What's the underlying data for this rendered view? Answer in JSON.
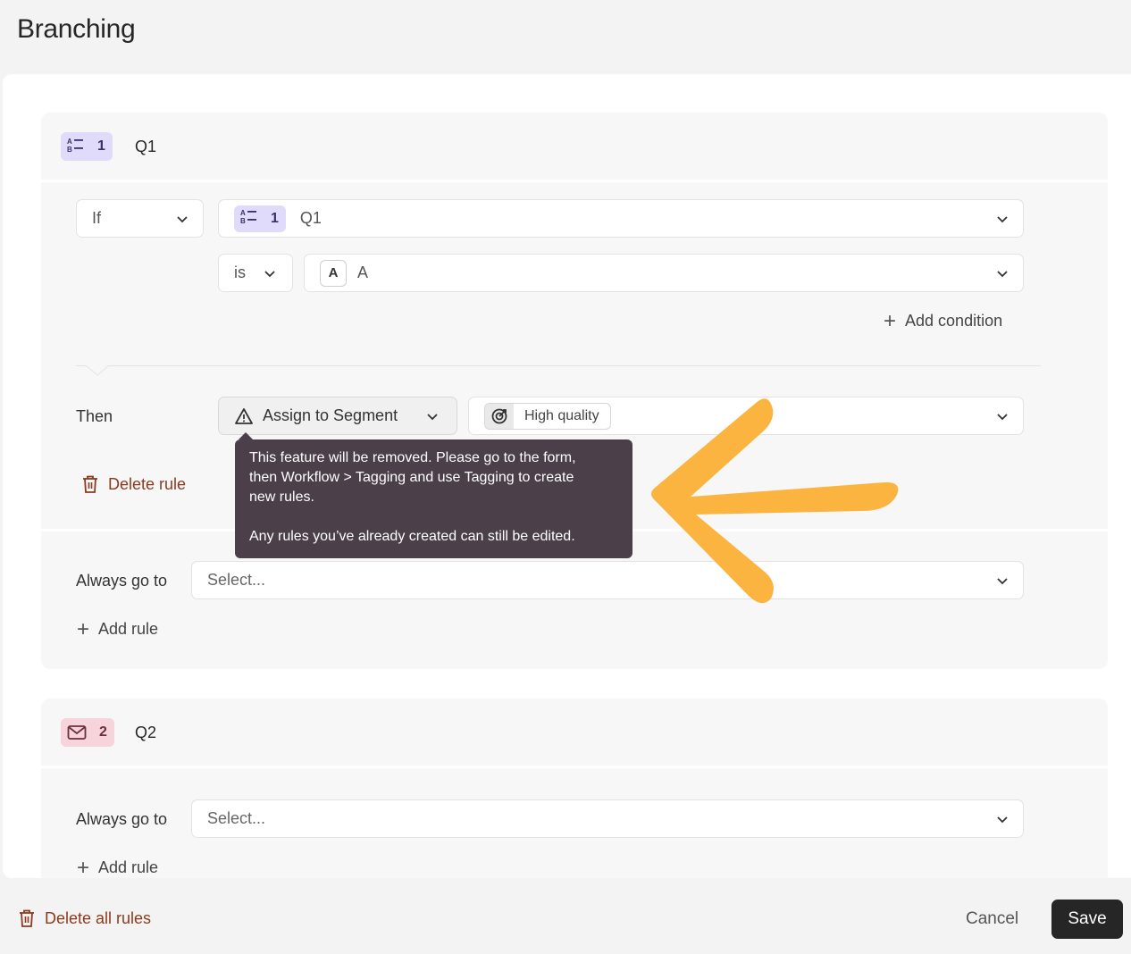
{
  "page": {
    "title": "Branching"
  },
  "question1": {
    "number": "1",
    "title": "Q1",
    "badge_color": "#e1dbfb",
    "icon": "multiple-choice-icon",
    "rule": {
      "if_label": "If",
      "question_number": "1",
      "question_title": "Q1",
      "operator": "is",
      "answer_letter": "A",
      "answer_value": "A",
      "add_condition_label": "Add condition",
      "then_label": "Then",
      "action_label": "Assign to Segment",
      "segment_value": "High quality",
      "delete_rule_label": "Delete rule"
    },
    "always_go_to_label": "Always go to",
    "always_go_to_placeholder": "Select...",
    "add_rule_label": "Add rule"
  },
  "tooltip": {
    "line1": "This feature will be removed. Please go to the form,",
    "line2": "then Workflow > Tagging and use Tagging to create",
    "line3": "new rules.",
    "line4": "Any rules you’ve already created can still be edited."
  },
  "question2": {
    "number": "2",
    "title": "Q2",
    "badge_color": "#f7d3dc",
    "icon": "mail-icon",
    "always_go_to_label": "Always go to",
    "always_go_to_placeholder": "Select...",
    "add_rule_label": "Add rule"
  },
  "footer": {
    "delete_all_label": "Delete all rules",
    "cancel_label": "Cancel",
    "save_label": "Save"
  },
  "colors": {
    "accent_arrow": "#fbb440",
    "danger_text": "#8a3b1f",
    "save_bg": "#262627"
  }
}
